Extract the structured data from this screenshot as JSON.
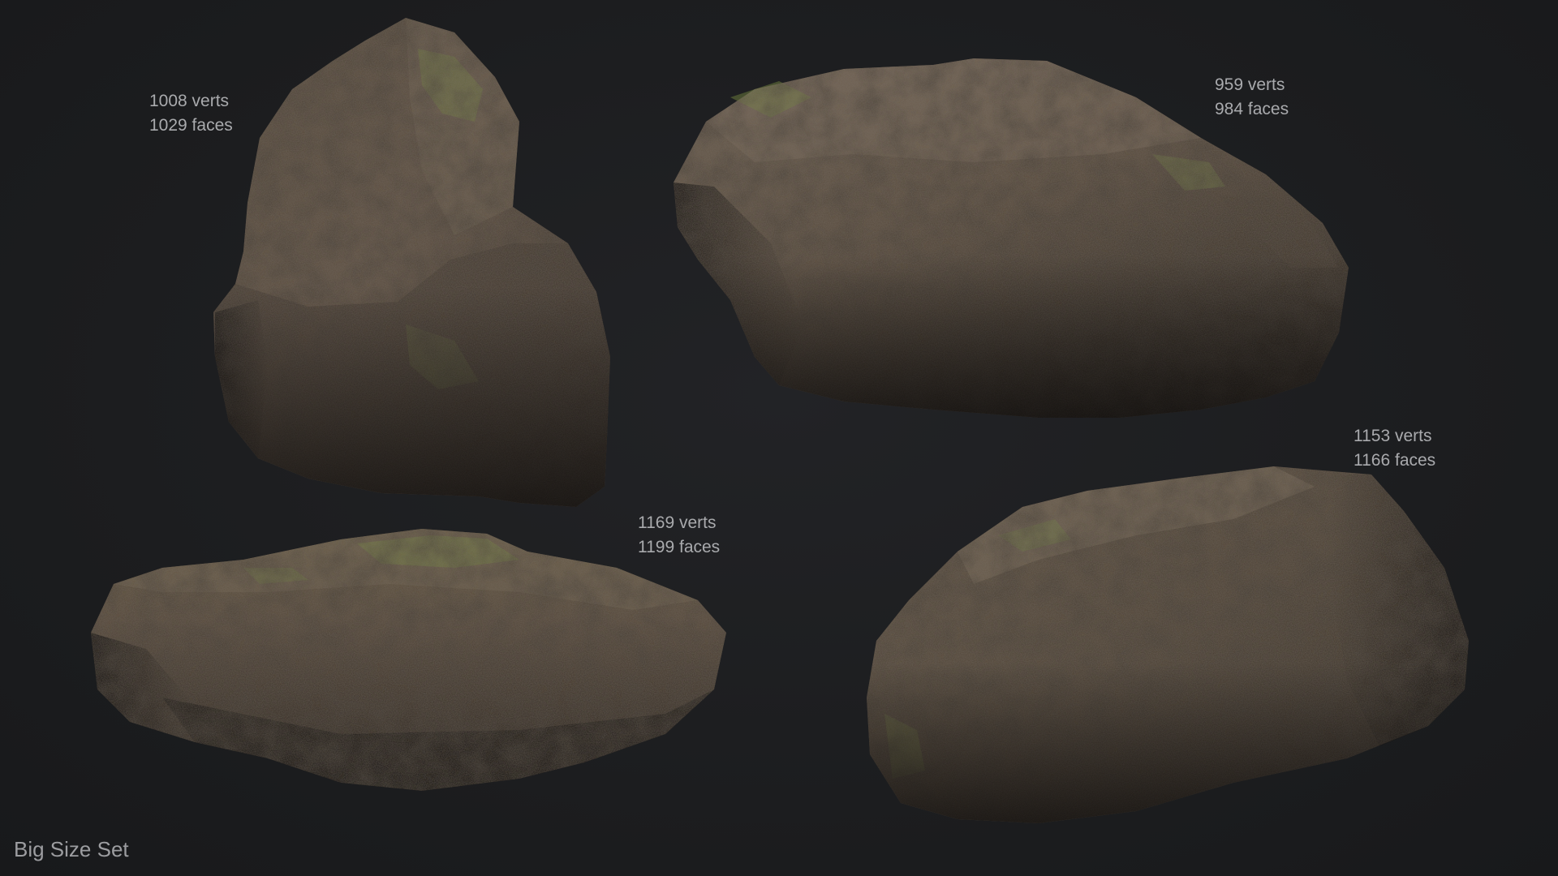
{
  "rocks": [
    {
      "verts": "1008 verts",
      "faces": "1029 faces"
    },
    {
      "verts": "959 verts",
      "faces": "984 faces"
    },
    {
      "verts": "1169 verts",
      "faces": "1199 faces"
    },
    {
      "verts": "1153 verts",
      "faces": "1166 faces"
    }
  ],
  "caption": "Big Size Set",
  "colors": {
    "background": "#1b1c1e",
    "rock_base": "#5b4d40",
    "rock_shadow": "#221d19",
    "moss": "#6f7f3e",
    "label_text": "#a9aaad"
  }
}
